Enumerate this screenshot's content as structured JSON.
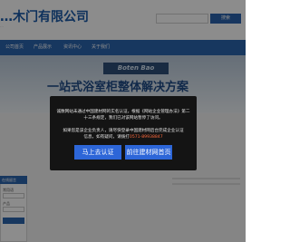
{
  "header": {
    "company_name": "…木门有限公司",
    "company_sub": "…",
    "search_placeholder": "",
    "search_button": "搜索"
  },
  "nav": {
    "items": [
      {
        "label": "公司首页"
      },
      {
        "label": "产品展示"
      },
      {
        "label": "资讯中心"
      },
      {
        "label": "关于我们"
      }
    ]
  },
  "banner": {
    "logo_text": "Boten Bao",
    "slogan": "一站式浴室柜整体解决方案"
  },
  "side": {
    "title": "在线留言",
    "label_1": "常用语",
    "label_2": "产品"
  },
  "modal": {
    "line_1": "诚数网站未通过中国建材网的实名认证，根据《网站企业管理办法》第二",
    "line_2": "十三条规定，我们已对该网站暂停了访问。",
    "line_3": "如果您是该企业负责人，请尽快登录中国建材网后台完成企业认证",
    "line_4_prefix": "信息，如有疑问，请拨打",
    "phone": "0571-89938847",
    "btn_verify": "马上去认证",
    "btn_home": "前往建材网首页"
  },
  "colors": {
    "accent": "#2b64ae",
    "modal_bg": "#141414",
    "button": "#2d66d8",
    "phone": "#ff6a3d"
  }
}
